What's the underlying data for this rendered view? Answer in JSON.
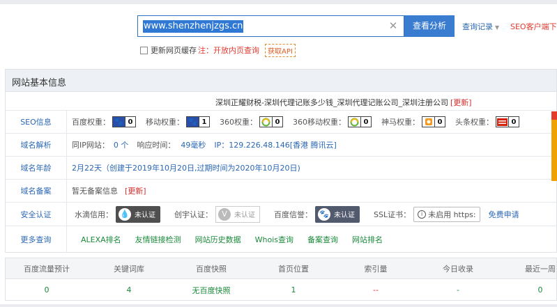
{
  "search": {
    "value": "www.shenzhenjzgs.cn",
    "analyze_label": "查看分析",
    "history_label": "查询记录",
    "seo_link": "SEO客户端下载"
  },
  "cache": {
    "label": "更新网页缓存",
    "note": "注：开放内页查询",
    "api_label": "获取API"
  },
  "panel": {
    "title": "网站基本信息",
    "site_title": "深圳正耀财税-深圳代理记账多少钱_深圳代理记账公司_深圳注册公司",
    "update_label": "[更新]"
  },
  "seo": {
    "label": "SEO信息",
    "items": [
      {
        "label": "百度权重：",
        "icon": "baidu-paw-icon",
        "value": "0"
      },
      {
        "label": "移动权重：",
        "icon": "mobile-paw-icon",
        "value": "1"
      },
      {
        "label": "360权重：",
        "icon": "360-icon",
        "value": "0"
      },
      {
        "label": "360移动权重：",
        "icon": "360-mobile-icon",
        "value": "0"
      },
      {
        "label": "神马权重：",
        "icon": "shenma-icon",
        "value": "0"
      },
      {
        "label": "头条权重：",
        "icon": "toutiao-icon",
        "value": "0"
      }
    ]
  },
  "domain": {
    "label": "域名解析",
    "same_ip_label": "同IP网站：",
    "same_ip_value": "0 个",
    "response_label": "响应时间：",
    "response_value": "49毫秒",
    "ip_text": "IP：129.226.48.146[香港 腾讯云]"
  },
  "age": {
    "label": "域名年龄",
    "text": "2月22天（创建于2019年10月20日,过期时间为2020年10月20日)"
  },
  "record": {
    "label": "域名备案",
    "text": "暂无备案信息",
    "update_label": "[更新]"
  },
  "security": {
    "label": "安全认证",
    "water_label": "水滴信用：",
    "water_status": "未认证",
    "chuangyu_label": "创宇认证：",
    "chuangyu_status": "未认证",
    "baidu_label": "百度信誉：",
    "baidu_status": "未认证",
    "ssl_label": "SSL证书：",
    "ssl_status": "未启用 https:",
    "free_apply": "免费申请"
  },
  "more": {
    "label": "更多查询",
    "links": [
      "ALEXA排名",
      "友情链接检测",
      "网站历史数据",
      "Whois查询",
      "备案查询",
      "网站排名"
    ]
  },
  "stats": {
    "headers": [
      "百度流量预计",
      "关键词库",
      "百度快照",
      "首页位置",
      "索引量",
      "今日收录",
      "最近一周"
    ],
    "values": [
      "0",
      "4",
      "无百度快照",
      "1",
      "--",
      "-",
      "0"
    ]
  },
  "colors": {
    "accent": "#3a7ccf",
    "link": "#2a67b5",
    "alert": "#e03a2f",
    "green": "#1a8a3a"
  }
}
